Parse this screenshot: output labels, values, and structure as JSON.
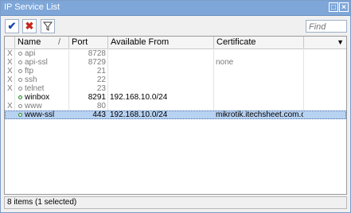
{
  "window": {
    "title": "IP Service List"
  },
  "toolbar": {
    "find_placeholder": "Find"
  },
  "columns": [
    "Name",
    "Port",
    "Available From",
    "Certificate"
  ],
  "services": [
    {
      "flag": "X",
      "name": "api",
      "port": "8728",
      "available_from": "",
      "certificate": "",
      "disabled": true,
      "selected": false
    },
    {
      "flag": "X",
      "name": "api-ssl",
      "port": "8729",
      "available_from": "",
      "certificate": "none",
      "disabled": true,
      "selected": false
    },
    {
      "flag": "X",
      "name": "ftp",
      "port": "21",
      "available_from": "",
      "certificate": "",
      "disabled": true,
      "selected": false
    },
    {
      "flag": "X",
      "name": "ssh",
      "port": "22",
      "available_from": "",
      "certificate": "",
      "disabled": true,
      "selected": false
    },
    {
      "flag": "X",
      "name": "telnet",
      "port": "23",
      "available_from": "",
      "certificate": "",
      "disabled": true,
      "selected": false
    },
    {
      "flag": "",
      "name": "winbox",
      "port": "8291",
      "available_from": "192.168.10.0/24",
      "certificate": "",
      "disabled": false,
      "selected": false
    },
    {
      "flag": "X",
      "name": "www",
      "port": "80",
      "available_from": "",
      "certificate": "",
      "disabled": true,
      "selected": false
    },
    {
      "flag": "",
      "name": "www-ssl",
      "port": "443",
      "available_from": "192.168.10.0/24",
      "certificate": "mikrotik.itechsheet.com.crt",
      "disabled": false,
      "selected": true
    }
  ],
  "status": {
    "text": "8 items (1 selected)"
  }
}
